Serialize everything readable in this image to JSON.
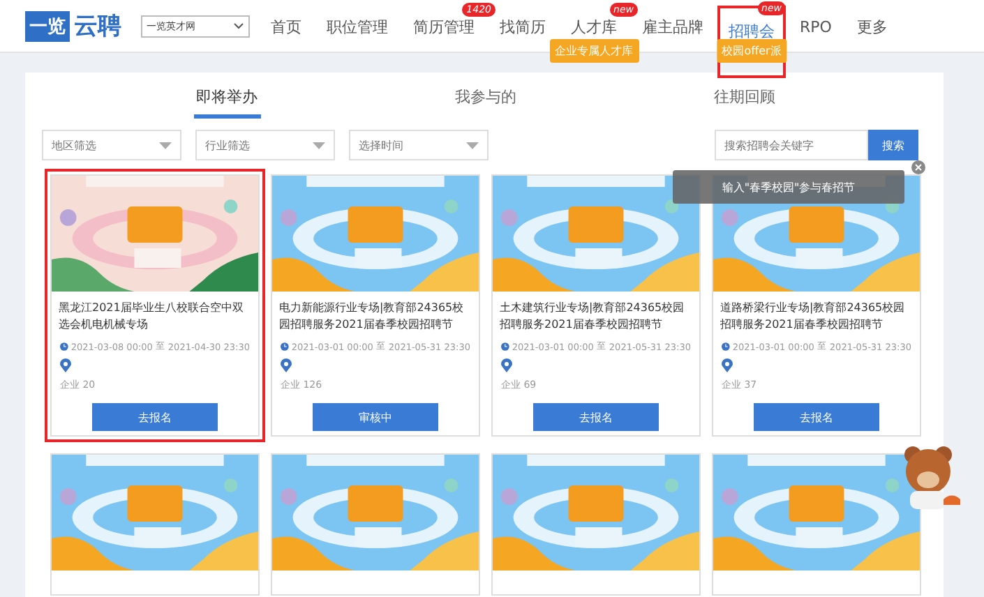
{
  "header": {
    "logo_mark": "一览",
    "logo_text": "云聘",
    "site_select": "一览英才网",
    "nav": [
      {
        "label": "首页",
        "selected": false
      },
      {
        "label": "职位管理",
        "selected": false
      },
      {
        "label": "简历管理",
        "selected": false,
        "badge": "1420"
      },
      {
        "label": "找简历",
        "selected": false
      },
      {
        "label": "人才库",
        "selected": false,
        "badge": "new",
        "tag": "企业专属人才库"
      },
      {
        "label": "雇主品牌",
        "selected": false
      },
      {
        "label": "招聘会",
        "selected": true,
        "badge": "new",
        "tag": "校园offer派",
        "highlighted": true
      },
      {
        "label": "RPO",
        "selected": false
      },
      {
        "label": "更多",
        "selected": false
      }
    ]
  },
  "tabs": [
    {
      "label": "即将举办",
      "selected": true
    },
    {
      "label": "我参与的",
      "selected": false
    },
    {
      "label": "往期回顾",
      "selected": false
    }
  ],
  "filters": [
    {
      "placeholder": "地区筛选"
    },
    {
      "placeholder": "行业筛选"
    },
    {
      "placeholder": "选择时间"
    }
  ],
  "search": {
    "placeholder": "搜索招聘会关键字",
    "button": "搜索"
  },
  "tooltip": "输入\"春季校园\"参与春招节",
  "fairs": [
    {
      "title": "黑龙江2021届毕业生八校联合空中双选会机电机械专场",
      "start": "2021-03-08 00:00",
      "to": "至",
      "end": "2021-04-30 23:30",
      "companies": "企业 20",
      "action": "去报名",
      "highlighted": true
    },
    {
      "title": "电力新能源行业专场|教育部24365校园招聘服务2021届春季校园招聘节",
      "start": "2021-03-01 00:00",
      "to": "至",
      "end": "2021-05-31 23:30",
      "companies": "企业 126",
      "action": "审核中",
      "highlighted": false
    },
    {
      "title": "土木建筑行业专场|教育部24365校园招聘服务2021届春季校园招聘节",
      "start": "2021-03-01 00:00",
      "to": "至",
      "end": "2021-05-31 23:30",
      "companies": "企业 69",
      "action": "去报名",
      "highlighted": false
    },
    {
      "title": "道路桥梁行业专场|教育部24365校园招聘服务2021届春季校园招聘节",
      "start": "2021-03-01 00:00",
      "to": "至",
      "end": "2021-05-31 23:30",
      "companies": "企业 37",
      "action": "去报名",
      "highlighted": false
    }
  ]
}
